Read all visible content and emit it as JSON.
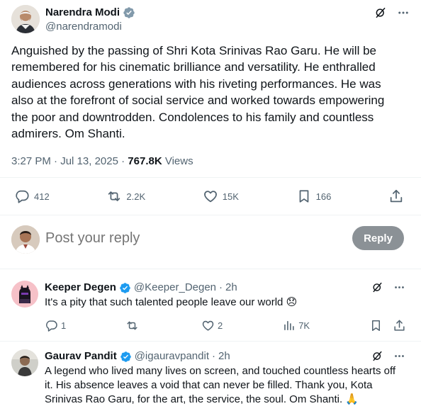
{
  "main_tweet": {
    "author_name": "Narendra Modi",
    "author_handle": "@narendramodi",
    "text": "Anguished by the passing of Shri Kota Srinivas Rao Garu. He will be\nremembered for his cinematic brilliance and versatility. He enthralled\naudiences across generations with his riveting performances. He was\nalso at the forefront of social service and worked towards empowering\nthe poor and downtrodden. Condolences to his family and countless\nadmirers. Om Shanti.",
    "time": "3:27 PM",
    "date": "Jul 13, 2025",
    "separator": "·",
    "views_count": "767.8K",
    "views_label": "Views",
    "replies": "412",
    "reposts": "2.2K",
    "likes": "15K",
    "bookmarks": "166"
  },
  "composer": {
    "placeholder": "Post your reply",
    "reply_label": "Reply"
  },
  "replies": [
    {
      "name": "Keeper Degen",
      "handle": "@Keeper_Degen",
      "separator": "·",
      "time": "2h",
      "text": "It's a pity that such talented people leave our world 😞",
      "replies": "1",
      "reposts": "",
      "likes": "2",
      "views": "7K"
    },
    {
      "name": "Gaurav Pandit",
      "handle": "@igauravpandit",
      "separator": "·",
      "time": "2h",
      "text": "A legend who lived many lives on screen, and touched countless hearts off it. His absence leaves a void that can never be filled. Thank you, Kota Srinivas Rao Garu, for the art, the service, the soul. Om Shanti. 🙏"
    }
  ],
  "colors": {
    "verified": "#1d9bf0",
    "muted": "#536471",
    "text": "#0f1419",
    "reply_button": "#8b9196",
    "divider": "#eff3f4"
  },
  "icons": [
    "verified-badge-icon",
    "grok-icon",
    "more-icon",
    "reply-icon",
    "repost-icon",
    "like-icon",
    "bookmark-icon",
    "share-icon",
    "views-icon"
  ]
}
